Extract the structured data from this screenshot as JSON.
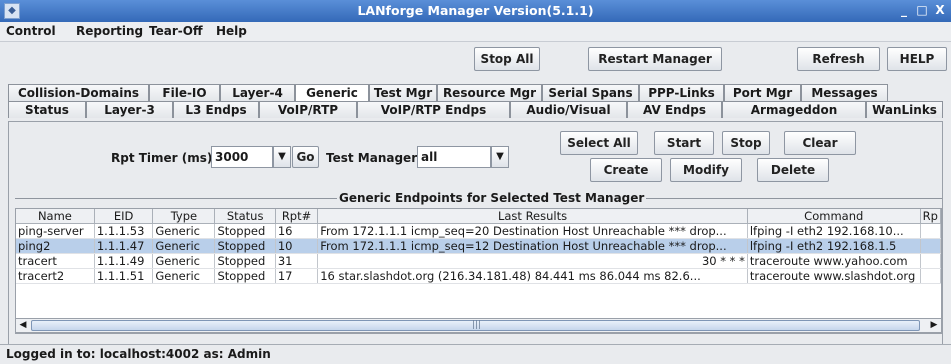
{
  "window": {
    "title": "LANforge Manager   Version(5.1.1)",
    "controls": [
      "_",
      "□",
      "X"
    ]
  },
  "menubar": {
    "items": [
      {
        "label": "Control"
      },
      {
        "label": "Reporting"
      },
      {
        "label": "Tear-Off"
      },
      {
        "label": "Help"
      }
    ]
  },
  "toolbar": {
    "stop_all": "Stop All",
    "restart_manager": "Restart Manager",
    "refresh": "Refresh",
    "help": "HELP"
  },
  "tabs": {
    "row1": [
      "Collision-Domains",
      "File-IO",
      "Layer-4",
      "Generic",
      "Test Mgr",
      "Resource Mgr",
      "Serial Spans",
      "PPP-Links",
      "Port Mgr",
      "Messages"
    ],
    "row2": [
      "Status",
      "Layer-3",
      "L3 Endps",
      "VoIP/RTP",
      "VoIP/RTP Endps",
      "Audio/Visual",
      "AV Endps",
      "Armageddon",
      "WanLinks"
    ],
    "active": "Generic"
  },
  "controls": {
    "rpt_timer_label": "Rpt Timer (ms):",
    "rpt_timer_value": "3000",
    "go": "Go",
    "test_manager_label": "Test Manager",
    "test_manager_value": "all",
    "select_all": "Select All",
    "start": "Start",
    "stop": "Stop",
    "clear": "Clear",
    "create": "Create",
    "modify": "Modify",
    "delete": "Delete"
  },
  "group_title": "Generic Endpoints for Selected Test Manager",
  "table": {
    "columns": [
      "Name",
      "EID",
      "Type",
      "Status",
      "Rpt#",
      "Last Results",
      "Command",
      "Rp"
    ],
    "rows": [
      {
        "name": "ping-server",
        "eid": "1.1.1.53",
        "type": "Generic",
        "status": "Stopped",
        "rpt": "16",
        "last": "From 172.1.1.1 icmp_seq=20 Destination Host Unreachable *** drop...",
        "cmd": "lfping  -I eth2 192.168.10..."
      },
      {
        "name": "ping2",
        "eid": "1.1.1.47",
        "type": "Generic",
        "status": "Stopped",
        "rpt": "10",
        "last": "From 172.1.1.1 icmp_seq=12 Destination Host Unreachable *** drop...",
        "cmd": "lfping  -I eth2 192.168.1.5",
        "selected": true
      },
      {
        "name": "tracert",
        "eid": "1.1.1.49",
        "type": "Generic",
        "status": "Stopped",
        "rpt": "31",
        "last": "30  * * *",
        "cmd": "traceroute www.yahoo.com"
      },
      {
        "name": "tracert2",
        "eid": "1.1.1.51",
        "type": "Generic",
        "status": "Stopped",
        "rpt": "17",
        "last": "16  star.slashdot.org (216.34.181.48)  84.441 ms  86.044 ms  82.6...",
        "cmd": "traceroute www.slashdot.org"
      }
    ]
  },
  "statusbar": {
    "text": "Logged in to:  localhost:4002  as:  Admin"
  }
}
